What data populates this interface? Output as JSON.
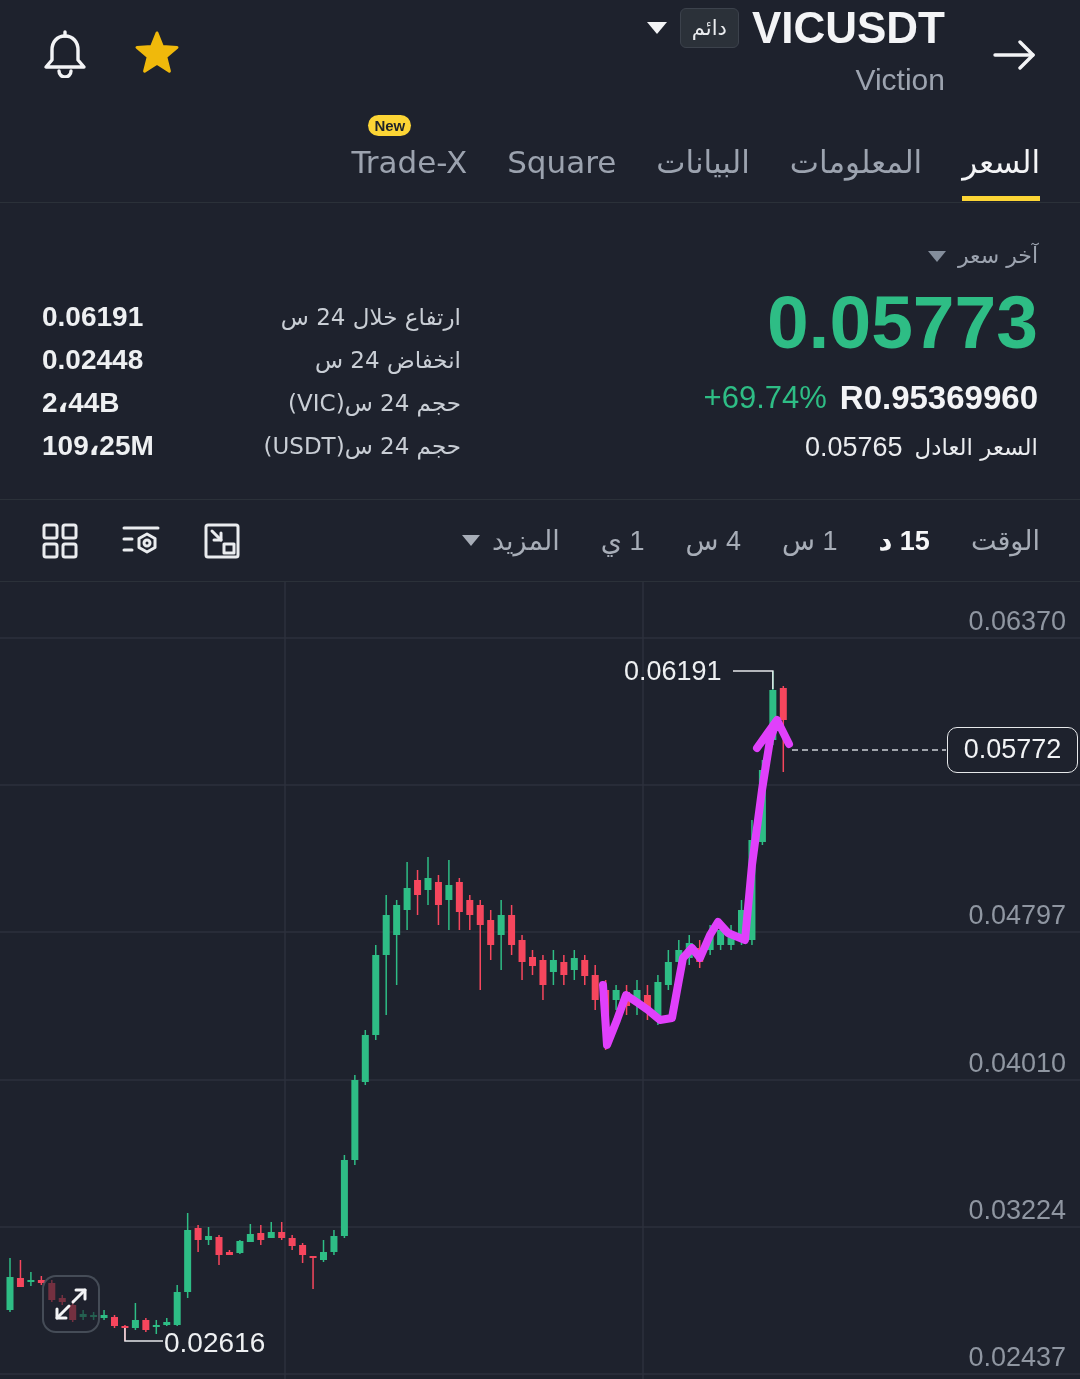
{
  "header": {
    "symbol": "VICUSDT",
    "contract_type": "دائم",
    "name": "Viction",
    "favorite": true
  },
  "tabs": [
    {
      "label": "السعر",
      "selected": true
    },
    {
      "label": "المعلومات",
      "selected": false
    },
    {
      "label": "البيانات",
      "selected": false
    },
    {
      "label": "Square",
      "selected": false
    },
    {
      "label": "Trade-X",
      "selected": false,
      "badge": "New"
    }
  ],
  "price_panel": {
    "label": "آخر سعر",
    "last_price": "0.05773",
    "rising": true,
    "change": "+69.74%",
    "converted_price": "R0.95369960",
    "fair_price_label": "السعر العادل",
    "fair_price": "0.05765"
  },
  "stats": [
    {
      "label": "ارتفاع خلال 24 س",
      "value": "0.06191"
    },
    {
      "label": "انخفاض 24 س",
      "value": "0.02448"
    },
    {
      "label": "حجم 24 س(VIC)",
      "value": "2،44B"
    },
    {
      "label": "حجم 24 س(USDT)",
      "value": "109،25M"
    }
  ],
  "intervals": [
    {
      "label": "الوقت",
      "kind": "option",
      "selected": false
    },
    {
      "label": "15 د",
      "kind": "option",
      "selected": true
    },
    {
      "label": "1 س",
      "kind": "option",
      "selected": false
    },
    {
      "label": "4 س",
      "kind": "option",
      "selected": false
    },
    {
      "label": "1 ي",
      "kind": "option",
      "selected": false
    },
    {
      "label": "المزيد",
      "kind": "menu",
      "selected": false
    }
  ],
  "chart": {
    "axis_labels": [
      "0.06370",
      "0.04797",
      "0.04010",
      "0.03224",
      "0.02437"
    ],
    "high_label": "0.06191",
    "low_label": "0.02616",
    "last_price_tag": "0.05772"
  }
}
